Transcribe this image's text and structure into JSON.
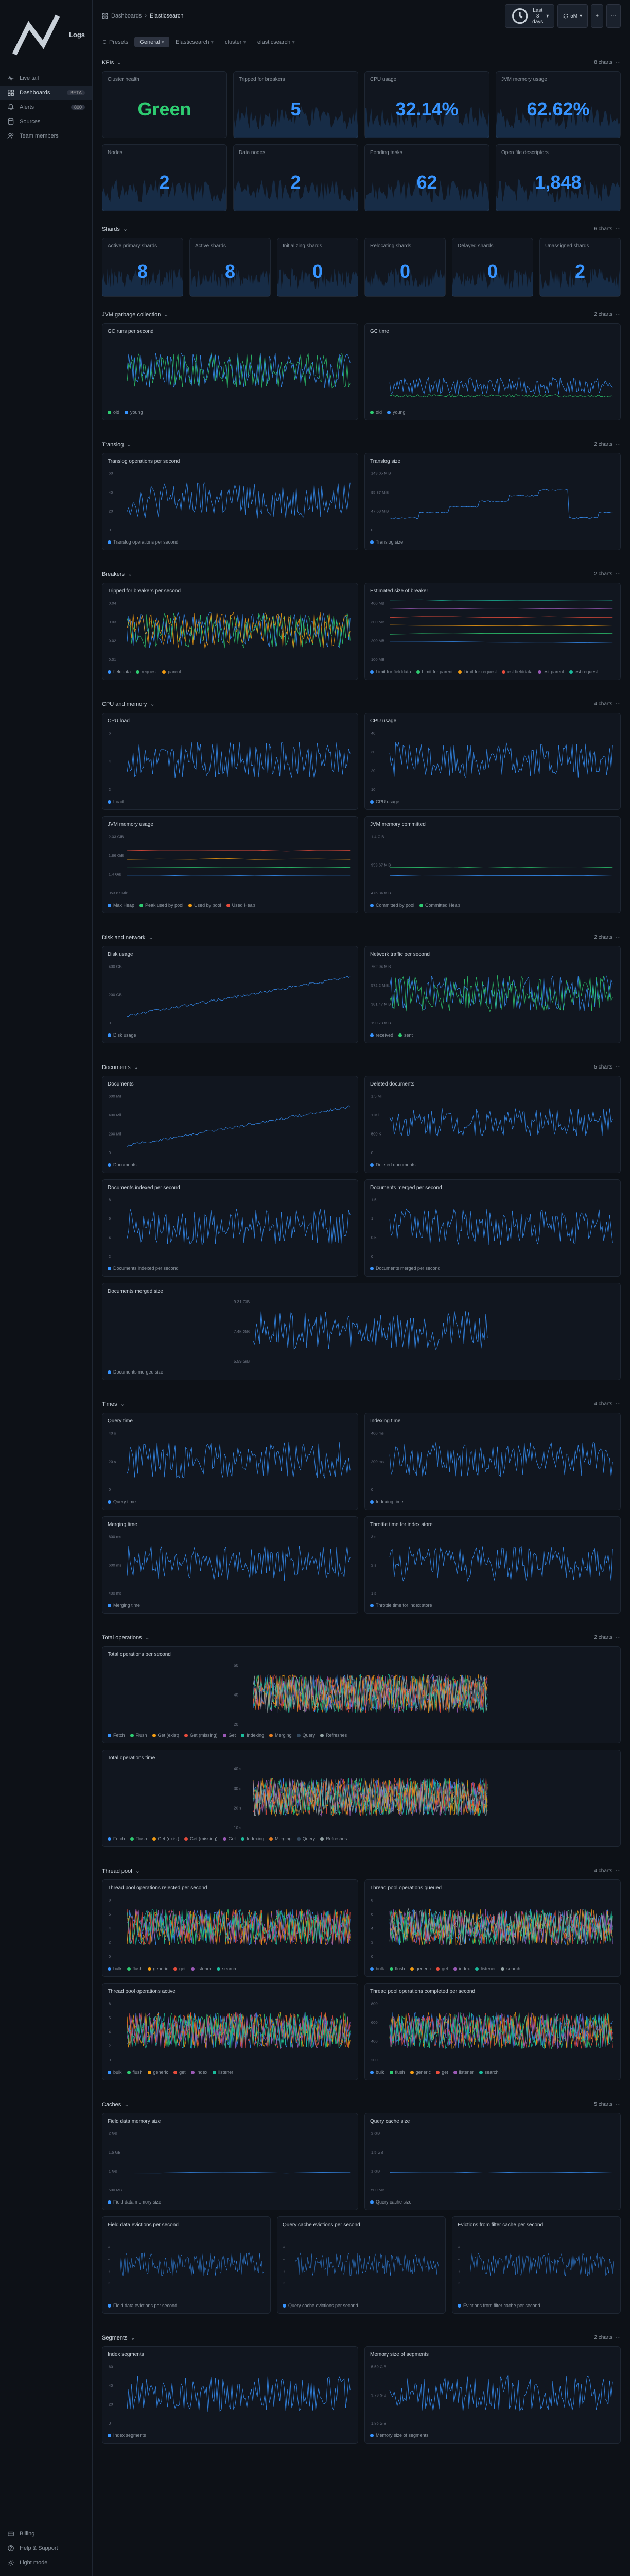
{
  "brand": "Logs",
  "nav": [
    {
      "label": "Live tail",
      "icon": "pulse"
    },
    {
      "label": "Dashboards",
      "icon": "grid",
      "badge": "BETA",
      "active": true
    },
    {
      "label": "Alerts",
      "icon": "bell",
      "badge": "800"
    },
    {
      "label": "Sources",
      "icon": "db"
    },
    {
      "label": "Team members",
      "icon": "users"
    }
  ],
  "nav_bottom": [
    {
      "label": "Billing",
      "icon": "card"
    },
    {
      "label": "Help & Support",
      "icon": "help"
    },
    {
      "label": "Light mode",
      "icon": "sun"
    }
  ],
  "breadcrumb": [
    "Dashboards",
    "Elasticsearch"
  ],
  "header_buttons": {
    "time": "Last 3 days",
    "refresh": "5M"
  },
  "tabs_label": "Presets",
  "tabs": [
    "General",
    "Elasticsearch",
    "cluster",
    "elasticsearch"
  ],
  "active_tab": 0,
  "kpi_section": {
    "title": "KPIs",
    "count": "8 charts"
  },
  "kpis": [
    {
      "title": "Cluster health",
      "value": "Green",
      "cls": "green",
      "spark": false
    },
    {
      "title": "Tripped for breakers",
      "value": "5",
      "spark": true
    },
    {
      "title": "CPU usage",
      "value": "32.14%",
      "spark": true
    },
    {
      "title": "JVM memory usage",
      "value": "62.62%",
      "spark": true
    },
    {
      "title": "Nodes",
      "value": "2",
      "spark": true
    },
    {
      "title": "Data nodes",
      "value": "2",
      "spark": true
    },
    {
      "title": "Pending tasks",
      "value": "62",
      "spark": true
    },
    {
      "title": "Open file descriptors",
      "value": "1,848",
      "spark": true
    }
  ],
  "shards_section": {
    "title": "Shards",
    "count": "6 charts"
  },
  "shards": [
    {
      "title": "Active primary shards",
      "value": "8"
    },
    {
      "title": "Active shards",
      "value": "8"
    },
    {
      "title": "Initializing shards",
      "value": "0"
    },
    {
      "title": "Relocating shards",
      "value": "0"
    },
    {
      "title": "Delayed shards",
      "value": "0"
    },
    {
      "title": "Unassigned shards",
      "value": "2"
    }
  ],
  "sections": [
    {
      "title": "JVM garbage collection",
      "count": "2 charts",
      "panels": [
        {
          "title": "GC runs per second",
          "legend": [
            {
              "c": "#2ecc71",
              "t": "old"
            },
            {
              "c": "#3794ff",
              "t": "young"
            }
          ],
          "style": "dense2"
        },
        {
          "title": "GC time",
          "legend": [
            {
              "c": "#2ecc71",
              "t": "old"
            },
            {
              "c": "#3794ff",
              "t": "young"
            }
          ],
          "style": "low2"
        }
      ]
    },
    {
      "title": "Translog",
      "count": "2 charts",
      "panels": [
        {
          "title": "Translog operations per second",
          "legend": [
            {
              "c": "#3794ff",
              "t": "Translog operations per second"
            }
          ],
          "style": "single",
          "yaxis": [
            "60",
            "40",
            "20",
            "0"
          ]
        },
        {
          "title": "Translog size",
          "legend": [
            {
              "c": "#3794ff",
              "t": "Translog size"
            }
          ],
          "style": "step",
          "yaxis": [
            "143.05 MiB",
            "95.37 MiB",
            "47.68 MiB",
            "0"
          ]
        }
      ]
    },
    {
      "title": "Breakers",
      "count": "2 charts",
      "panels": [
        {
          "title": "Tripped for breakers per second",
          "legend": [
            {
              "c": "#3794ff",
              "t": "fielddata"
            },
            {
              "c": "#2ecc71",
              "t": "request"
            },
            {
              "c": "#f39c12",
              "t": "parent"
            }
          ],
          "style": "dense3",
          "yaxis": [
            "0.04",
            "0.03",
            "0.02",
            "0.01"
          ]
        },
        {
          "title": "Estimated size of breaker",
          "legend": [
            {
              "c": "#3794ff",
              "t": "Limit for fielddata"
            },
            {
              "c": "#2ecc71",
              "t": "Limit for parent"
            },
            {
              "c": "#f39c12",
              "t": "Limit for request"
            },
            {
              "c": "#e74c3c",
              "t": "est fielddata"
            },
            {
              "c": "#9b59b6",
              "t": "est parent"
            },
            {
              "c": "#1abc9c",
              "t": "est request"
            }
          ],
          "style": "flat",
          "yaxis": [
            "400 MB",
            "300 MB",
            "200 MB",
            "100 MB"
          ]
        }
      ]
    },
    {
      "title": "CPU and memory",
      "count": "4 charts",
      "panels": [
        {
          "title": "CPU load",
          "legend": [
            {
              "c": "#3794ff",
              "t": "Load"
            }
          ],
          "style": "single",
          "yaxis": [
            "6",
            "4",
            "2"
          ]
        },
        {
          "title": "CPU usage",
          "legend": [
            {
              "c": "#3794ff",
              "t": "CPU usage"
            }
          ],
          "style": "single",
          "yaxis": [
            "40",
            "30",
            "20",
            "10"
          ]
        },
        {
          "title": "JVM memory usage",
          "legend": [
            {
              "c": "#3794ff",
              "t": "Max Heap"
            },
            {
              "c": "#2ecc71",
              "t": "Peak used by pool"
            },
            {
              "c": "#f39c12",
              "t": "Used by pool"
            },
            {
              "c": "#e74c3c",
              "t": "Used Heap"
            }
          ],
          "style": "flat",
          "yaxis": [
            "2.33 GiB",
            "1.86 GiB",
            "1.4 GiB",
            "953.67 MiB"
          ]
        },
        {
          "title": "JVM memory committed",
          "legend": [
            {
              "c": "#3794ff",
              "t": "Committed by pool"
            },
            {
              "c": "#2ecc71",
              "t": "Committed Heap"
            }
          ],
          "style": "flat",
          "yaxis": [
            "1.4 GiB",
            "953.67 MiB",
            "476.84 MiB"
          ]
        }
      ]
    },
    {
      "title": "Disk and network",
      "count": "2 charts",
      "panels": [
        {
          "title": "Disk usage",
          "legend": [
            {
              "c": "#3794ff",
              "t": "Disk usage"
            }
          ],
          "style": "rising",
          "yaxis": [
            "400 GB",
            "200 GB",
            "0"
          ]
        },
        {
          "title": "Network traffic per second",
          "legend": [
            {
              "c": "#3794ff",
              "t": "received"
            },
            {
              "c": "#2ecc71",
              "t": "sent"
            }
          ],
          "style": "dense2",
          "yaxis": [
            "762.94 MiB",
            "572.2 MiB",
            "381.47 MiB",
            "190.73 MiB"
          ]
        }
      ]
    },
    {
      "title": "Documents",
      "count": "5 charts",
      "panels": [
        {
          "title": "Documents",
          "legend": [
            {
              "c": "#3794ff",
              "t": "Documents"
            }
          ],
          "style": "rising",
          "yaxis": [
            "600 Mil",
            "400 Mil",
            "200 Mil",
            "0"
          ]
        },
        {
          "title": "Deleted documents",
          "legend": [
            {
              "c": "#3794ff",
              "t": "Deleted documents"
            }
          ],
          "style": "noisy",
          "yaxis": [
            "1.5 Mil",
            "1 Mil",
            "500 K",
            "0"
          ]
        },
        {
          "title": "Documents indexed per second",
          "legend": [
            {
              "c": "#3794ff",
              "t": "Documents indexed per second"
            }
          ],
          "style": "single",
          "yaxis": [
            "8",
            "6",
            "4",
            "2"
          ]
        },
        {
          "title": "Documents merged per second",
          "legend": [
            {
              "c": "#3794ff",
              "t": "Documents merged per second"
            }
          ],
          "style": "single",
          "yaxis": [
            "1.5",
            "1",
            "0.5",
            "0"
          ]
        },
        {
          "title": "Documents merged size",
          "legend": [
            {
              "c": "#3794ff",
              "t": "Documents merged size"
            }
          ],
          "style": "single",
          "full": true,
          "yaxis": [
            "9.31 GiB",
            "7.45 GiB",
            "5.59 GiB"
          ]
        }
      ]
    },
    {
      "title": "Times",
      "count": "4 charts",
      "panels": [
        {
          "title": "Query time",
          "legend": [
            {
              "c": "#3794ff",
              "t": "Query time"
            }
          ],
          "style": "single",
          "yaxis": [
            "40 s",
            "20 s",
            "0"
          ]
        },
        {
          "title": "Indexing time",
          "legend": [
            {
              "c": "#3794ff",
              "t": "Indexing time"
            }
          ],
          "style": "single",
          "yaxis": [
            "400 ms",
            "200 ms",
            "0"
          ]
        },
        {
          "title": "Merging time",
          "legend": [
            {
              "c": "#3794ff",
              "t": "Merging time"
            }
          ],
          "style": "single",
          "yaxis": [
            "800 ms",
            "600 ms",
            "400 ms"
          ]
        },
        {
          "title": "Throttle time for index store",
          "legend": [
            {
              "c": "#3794ff",
              "t": "Throttle time for index store"
            }
          ],
          "style": "single",
          "yaxis": [
            "3 s",
            "2 s",
            "1 s"
          ]
        }
      ]
    },
    {
      "title": "Total operations",
      "count": "2 charts",
      "panels": [
        {
          "title": "Total operations per second",
          "legend": [
            {
              "c": "#3794ff",
              "t": "Fetch"
            },
            {
              "c": "#2ecc71",
              "t": "Flush"
            },
            {
              "c": "#f39c12",
              "t": "Get (exist)"
            },
            {
              "c": "#e74c3c",
              "t": "Get (missing)"
            },
            {
              "c": "#9b59b6",
              "t": "Get"
            },
            {
              "c": "#1abc9c",
              "t": "Indexing"
            },
            {
              "c": "#e67e22",
              "t": "Merging"
            },
            {
              "c": "#34495e",
              "t": "Query"
            },
            {
              "c": "#95a5a6",
              "t": "Refreshes"
            }
          ],
          "style": "multi",
          "full": true,
          "yaxis": [
            "60",
            "40",
            "20"
          ]
        },
        {
          "title": "Total operations time",
          "legend": [
            {
              "c": "#3794ff",
              "t": "Fetch"
            },
            {
              "c": "#2ecc71",
              "t": "Flush"
            },
            {
              "c": "#f39c12",
              "t": "Get (exist)"
            },
            {
              "c": "#e74c3c",
              "t": "Get (missing)"
            },
            {
              "c": "#9b59b6",
              "t": "Get"
            },
            {
              "c": "#1abc9c",
              "t": "Indexing"
            },
            {
              "c": "#e67e22",
              "t": "Merging"
            },
            {
              "c": "#34495e",
              "t": "Query"
            },
            {
              "c": "#95a5a6",
              "t": "Refreshes"
            }
          ],
          "style": "multi",
          "full": true,
          "yaxis": [
            "40 s",
            "30 s",
            "20 s",
            "10 s"
          ]
        }
      ]
    },
    {
      "title": "Thread pool",
      "count": "4 charts",
      "panels": [
        {
          "title": "Thread pool operations rejected per second",
          "legend": [
            {
              "c": "#3794ff",
              "t": "bulk"
            },
            {
              "c": "#2ecc71",
              "t": "flush"
            },
            {
              "c": "#f39c12",
              "t": "generic"
            },
            {
              "c": "#e74c3c",
              "t": "get"
            },
            {
              "c": "#9b59b6",
              "t": "listener"
            },
            {
              "c": "#1abc9c",
              "t": "search"
            }
          ],
          "style": "multi",
          "yaxis": [
            "8",
            "6",
            "4",
            "2",
            "0"
          ]
        },
        {
          "title": "Thread pool operations queued",
          "legend": [
            {
              "c": "#3794ff",
              "t": "bulk"
            },
            {
              "c": "#2ecc71",
              "t": "flush"
            },
            {
              "c": "#f39c12",
              "t": "generic"
            },
            {
              "c": "#e74c3c",
              "t": "get"
            },
            {
              "c": "#9b59b6",
              "t": "index"
            },
            {
              "c": "#1abc9c",
              "t": "listener"
            },
            {
              "c": "#95a5a6",
              "t": "search"
            }
          ],
          "style": "multi",
          "yaxis": [
            "8",
            "6",
            "4",
            "2",
            "0"
          ]
        },
        {
          "title": "Thread pool operations active",
          "legend": [
            {
              "c": "#3794ff",
              "t": "bulk"
            },
            {
              "c": "#2ecc71",
              "t": "flush"
            },
            {
              "c": "#f39c12",
              "t": "generic"
            },
            {
              "c": "#e74c3c",
              "t": "get"
            },
            {
              "c": "#9b59b6",
              "t": "index"
            },
            {
              "c": "#1abc9c",
              "t": "listener"
            }
          ],
          "style": "multi",
          "yaxis": [
            "8",
            "6",
            "4",
            "2",
            "0"
          ]
        },
        {
          "title": "Thread pool operations completed per second",
          "legend": [
            {
              "c": "#3794ff",
              "t": "bulk"
            },
            {
              "c": "#2ecc71",
              "t": "flush"
            },
            {
              "c": "#f39c12",
              "t": "generic"
            },
            {
              "c": "#e74c3c",
              "t": "get"
            },
            {
              "c": "#9b59b6",
              "t": "listener"
            },
            {
              "c": "#1abc9c",
              "t": "search"
            }
          ],
          "style": "multi",
          "yaxis": [
            "800",
            "600",
            "400",
            "200"
          ]
        }
      ]
    },
    {
      "title": "Caches",
      "count": "5 charts",
      "panels": [
        {
          "title": "Field data memory size",
          "legend": [
            {
              "c": "#3794ff",
              "t": "Field data memory size"
            }
          ],
          "style": "flat",
          "yaxis": [
            "2 GB",
            "1.5 GB",
            "1 GB",
            "500 MB"
          ]
        },
        {
          "title": "Query cache size",
          "legend": [
            {
              "c": "#3794ff",
              "t": "Query cache size"
            }
          ],
          "style": "flat",
          "yaxis": [
            "2 GB",
            "1.5 GB",
            "1 GB",
            "500 MB"
          ]
        }
      ],
      "panels3": [
        {
          "title": "Field data evictions per second",
          "legend": [
            {
              "c": "#3794ff",
              "t": "Field data evictions per second"
            }
          ],
          "style": "single",
          "yaxis": [
            "8",
            "6",
            "4",
            "2"
          ]
        },
        {
          "title": "Query cache evictions per second",
          "legend": [
            {
              "c": "#3794ff",
              "t": "Query cache evictions per second"
            }
          ],
          "style": "single",
          "yaxis": [
            "8",
            "6",
            "4",
            "2"
          ]
        },
        {
          "title": "Evictions from filter cache per second",
          "legend": [
            {
              "c": "#3794ff",
              "t": "Evictions from filter cache per second"
            }
          ],
          "style": "single",
          "yaxis": [
            "8",
            "6",
            "4",
            "2"
          ]
        }
      ]
    },
    {
      "title": "Segments",
      "count": "2 charts",
      "panels": [
        {
          "title": "Index segments",
          "legend": [
            {
              "c": "#3794ff",
              "t": "Index segments"
            }
          ],
          "style": "single",
          "yaxis": [
            "60",
            "40",
            "20",
            "0"
          ]
        },
        {
          "title": "Memory size of segments",
          "legend": [
            {
              "c": "#3794ff",
              "t": "Memory size of segments"
            }
          ],
          "style": "single",
          "yaxis": [
            "5.59 GiB",
            "3.73 GiB",
            "1.86 GiB"
          ]
        }
      ]
    }
  ],
  "chart_data": {
    "type": "dashboard",
    "note": "Multiple time-series panels over a 3-day window. Values shown are approximate readings from axis labels and visual estimation.",
    "kpi_values": {
      "cluster_health": "Green",
      "tripped_breakers": 5,
      "cpu_usage_pct": 32.14,
      "jvm_memory_pct": 62.62,
      "nodes": 2,
      "data_nodes": 2,
      "pending_tasks": 62,
      "open_file_descriptors": 1848
    },
    "shard_values": {
      "active_primary": 8,
      "active": 8,
      "initializing": 0,
      "relocating": 0,
      "delayed": 0,
      "unassigned": 2
    }
  }
}
